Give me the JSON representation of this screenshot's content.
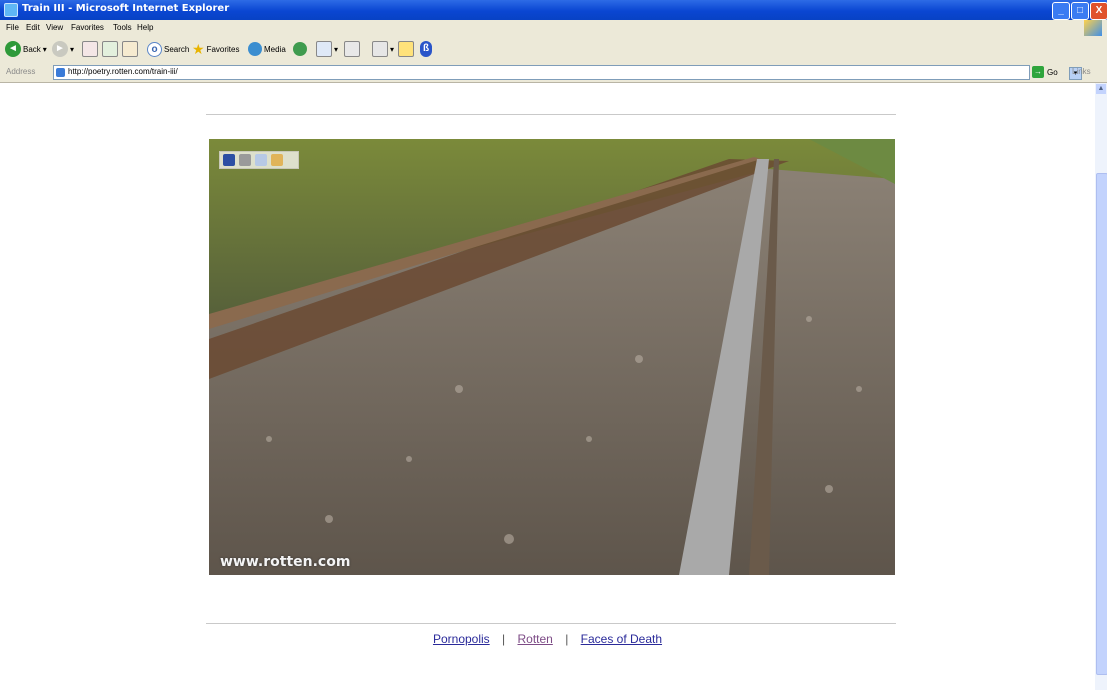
{
  "window": {
    "title": "Train III - Microsoft Internet Explorer",
    "min_glyph": "_",
    "max_glyph": "□",
    "close_glyph": "X"
  },
  "menu": [
    "File",
    "Edit",
    "View",
    "Favorites",
    "Tools",
    "Help"
  ],
  "toolbar": {
    "back_label": "Back",
    "search_label": "Search",
    "favorites_label": "Favorites",
    "media_label": "Media"
  },
  "address": {
    "label": "Address",
    "url": "http://poetry.rotten.com/train-iii/",
    "go_label": "Go",
    "links_label": "Links"
  },
  "content": {
    "photo_alt": "Railway track with gravel ballast",
    "watermark": "www.rotten.com"
  },
  "footer": {
    "links": [
      "Pornopolis",
      "Rotten",
      "Faces of Death"
    ],
    "separator": "|"
  },
  "colors": {
    "titlebar": "#0a46d2",
    "chrome": "#ece9d8",
    "link": "#2a2a9a",
    "visited": "#7d4b86"
  }
}
